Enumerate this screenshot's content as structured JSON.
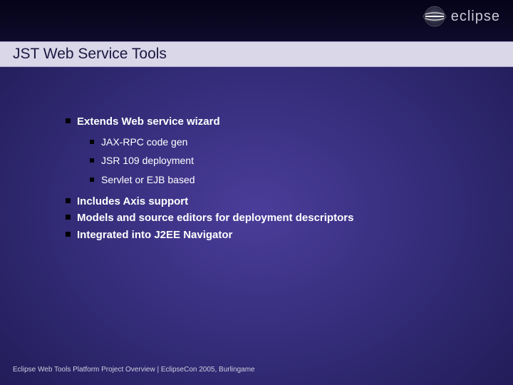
{
  "header": {
    "logo_text": "eclipse"
  },
  "title": "JST Web Service Tools",
  "bullets": {
    "b0": "Extends Web service wizard",
    "b0_sub": {
      "s0": "JAX-RPC code gen",
      "s1": "JSR 109 deployment",
      "s2": "Servlet or EJB based"
    },
    "b1": "Includes Axis support",
    "b2": "Models and source editors for deployment descriptors",
    "b3": "Integrated into J2EE Navigator"
  },
  "footer": "Eclipse Web Tools Platform Project Overview   |   EclipseCon 2005, Burlingame"
}
